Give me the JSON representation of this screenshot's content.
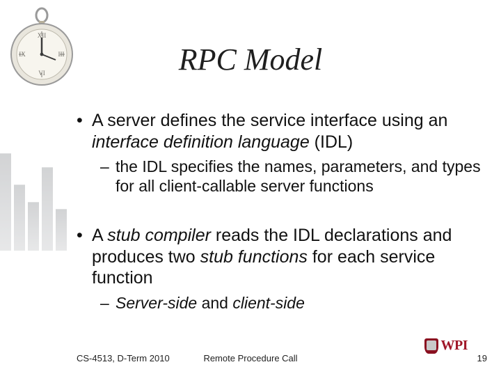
{
  "title": "RPC Model",
  "bullets": [
    {
      "pre": "A server defines the service interface using an ",
      "em1": "interface definition language",
      "post": " (IDL)",
      "sub": {
        "text": "the IDL specifies the names, parameters, and types for all client-callable server functions"
      }
    },
    {
      "pre": "A ",
      "em1": "stub compiler",
      "mid": " reads the IDL declarations and produces two ",
      "em2": "stub functions",
      "post": " for each service function",
      "sub": {
        "em_a": "Server-side",
        "mid": " and ",
        "em_b": "client-side"
      }
    }
  ],
  "footer": {
    "left": "CS-4513, D-Term 2010",
    "center": "Remote Procedure Call",
    "page": "19",
    "logo_text": "WPI"
  },
  "colors": {
    "accent": "#a01728"
  }
}
